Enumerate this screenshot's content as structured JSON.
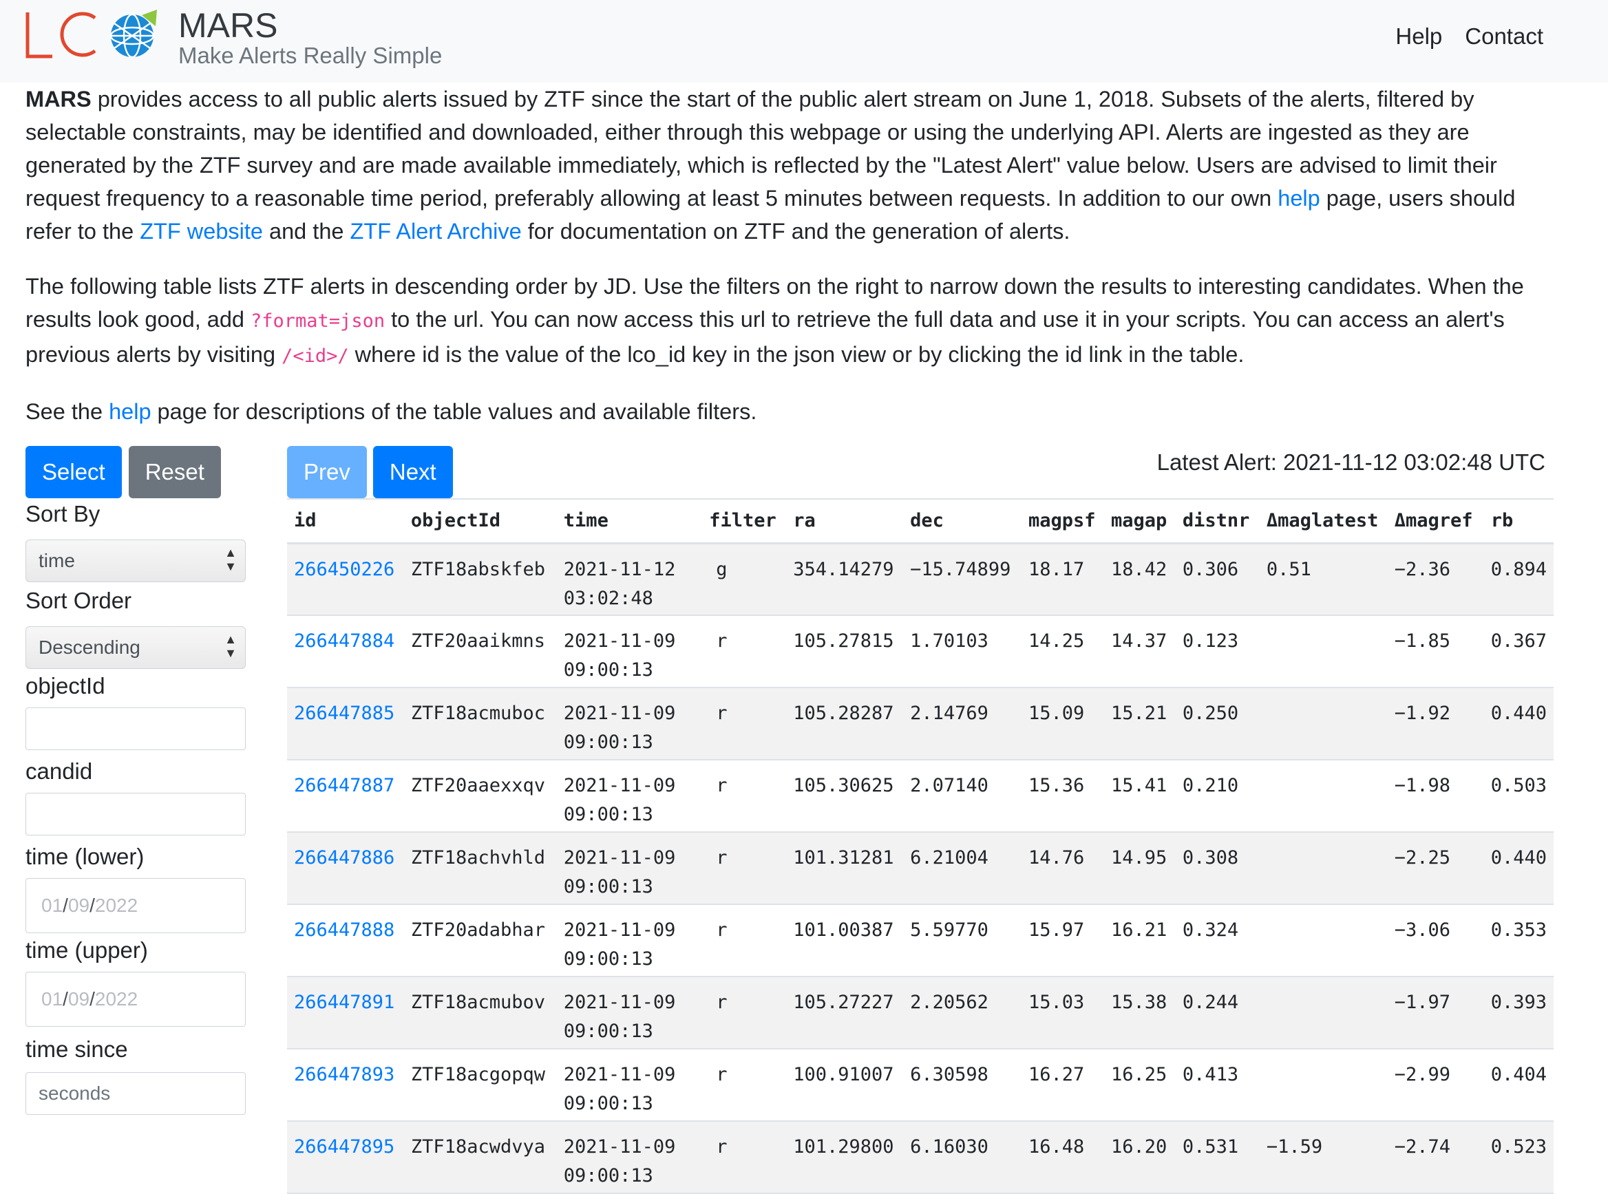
{
  "header": {
    "brand_title": "MARS",
    "brand_subtitle": "Make Alerts Really Simple",
    "nav": [
      "Help",
      "Contact"
    ]
  },
  "intro": {
    "p1": {
      "bold": "MARS",
      "t1": " provides access to all public alerts issued by ZTF since the start of the public alert stream on June 1, 2018. Subsets of the alerts, filtered by selectable constraints, may be identified and downloaded, either through this webpage or using the underlying API. Alerts are ingested as they are generated by the ZTF survey and are made available immediately, which is reflected by the \"Latest Alert\" value below. Users are advised to limit their request frequency to a reasonable time period, preferably allowing at least 5 minutes between requests. In addition to our own ",
      "link_help": "help",
      "t2": " page, users should refer to the ",
      "link_ztf": "ZTF website",
      "t3": " and the ",
      "link_archive": "ZTF Alert Archive",
      "t4": " for documentation on ZTF and the generation of alerts."
    },
    "p2": {
      "t1": "The following table lists ZTF alerts in descending order by JD. Use the filters on the right to narrow down the results to interesting candidates. When the results look good, add ",
      "code1": "?format=json",
      "t2": " to the url. You can now access this url to retrieve the full data and use it in your scripts. You can access an alert's previous alerts by visiting ",
      "code2": "/<id>/",
      "t3": " where id is the value of the lco_id key in the json view or by clicking the id link in the table."
    },
    "p3": {
      "t1": "See the ",
      "link_help": "help",
      "t2": " page for descriptions of the table values and available filters."
    }
  },
  "sidebar": {
    "select_label": "Select",
    "reset_label": "Reset",
    "sort_by_label": "Sort By",
    "sort_by_value": "time",
    "sort_order_label": "Sort Order",
    "sort_order_value": "Descending",
    "objectid_label": "objectId",
    "candid_label": "candid",
    "time_lower_label": "time (lower)",
    "time_lower_placeholder": {
      "mm": "01",
      "dd": "09",
      "yyyy": "2022"
    },
    "time_upper_label": "time (upper)",
    "time_upper_placeholder": {
      "mm": "01",
      "dd": "09",
      "yyyy": "2022"
    },
    "time_since_label": "time since",
    "time_since_placeholder": "seconds"
  },
  "pager": {
    "prev": "Prev",
    "next": "Next",
    "latest": "Latest Alert: 2021-11-12 03:02:48 UTC"
  },
  "table": {
    "columns": [
      "id",
      "objectId",
      "time",
      "filter",
      "ra",
      "dec",
      "magpsf",
      "magap",
      "distnr",
      "Δmaglatest",
      "Δmagref",
      "rb"
    ],
    "rows": [
      [
        "266450226",
        "ZTF18abskfeb",
        "2021-11-12",
        "03:02:48",
        "g",
        "354.14279",
        "-15.74899",
        "18.17",
        "18.42",
        "0.306",
        "0.51",
        "-2.36",
        "0.894"
      ],
      [
        "266447884",
        "ZTF20aaikmns",
        "2021-11-09",
        "09:00:13",
        "r",
        "105.27815",
        "1.70103",
        "14.25",
        "14.37",
        "0.123",
        "",
        "-1.85",
        "0.367"
      ],
      [
        "266447885",
        "ZTF18acmuboc",
        "2021-11-09",
        "09:00:13",
        "r",
        "105.28287",
        "2.14769",
        "15.09",
        "15.21",
        "0.250",
        "",
        "-1.92",
        "0.440"
      ],
      [
        "266447887",
        "ZTF20aaexxqv",
        "2021-11-09",
        "09:00:13",
        "r",
        "105.30625",
        "2.07140",
        "15.36",
        "15.41",
        "0.210",
        "",
        "-1.98",
        "0.503"
      ],
      [
        "266447886",
        "ZTF18achvhld",
        "2021-11-09",
        "09:00:13",
        "r",
        "101.31281",
        "6.21004",
        "14.76",
        "14.95",
        "0.308",
        "",
        "-2.25",
        "0.440"
      ],
      [
        "266447888",
        "ZTF20adabhar",
        "2021-11-09",
        "09:00:13",
        "r",
        "101.00387",
        "5.59770",
        "15.97",
        "16.21",
        "0.324",
        "",
        "-3.06",
        "0.353"
      ],
      [
        "266447891",
        "ZTF18acmubov",
        "2021-11-09",
        "09:00:13",
        "r",
        "105.27227",
        "2.20562",
        "15.03",
        "15.38",
        "0.244",
        "",
        "-1.97",
        "0.393"
      ],
      [
        "266447893",
        "ZTF18acgopqw",
        "2021-11-09",
        "09:00:13",
        "r",
        "100.91007",
        "6.30598",
        "16.27",
        "16.25",
        "0.413",
        "",
        "-2.99",
        "0.404"
      ],
      [
        "266447895",
        "ZTF18acwdvya",
        "2021-11-09",
        "09:00:13",
        "r",
        "101.29800",
        "6.16030",
        "16.48",
        "16.20",
        "0.531",
        "-1.59",
        "-2.74",
        "0.523"
      ]
    ]
  },
  "colors": {
    "primary": "#007bff",
    "secondary": "#6c757d",
    "code": "#e83e8c",
    "logo_red": "#e2482f",
    "logo_blue": "#1b8ad6",
    "logo_green": "#8dc63f"
  },
  "icons": {
    "logo": "lco-globe-logo",
    "select_arrows": "updown-arrows-icon"
  }
}
